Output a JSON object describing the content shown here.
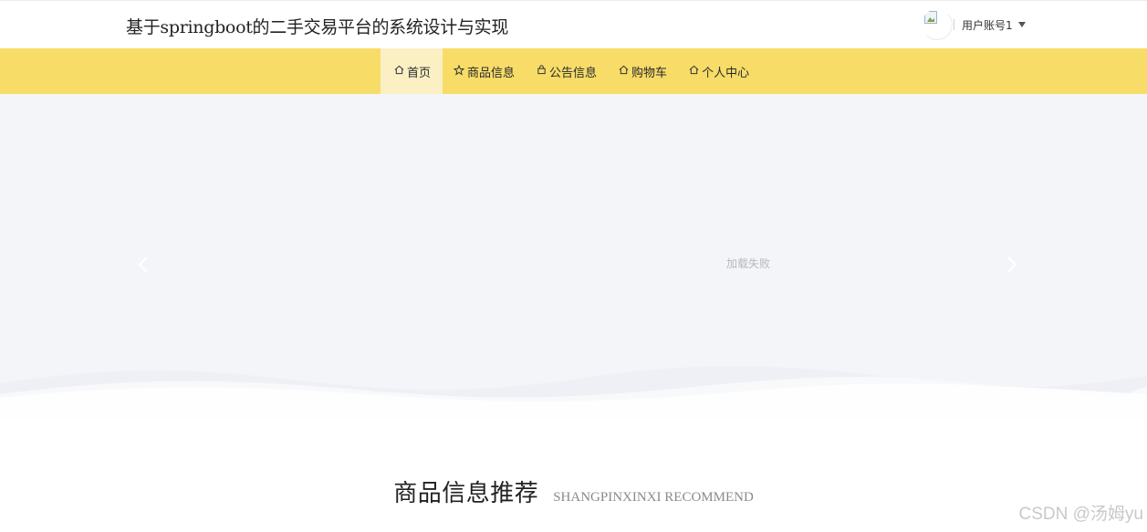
{
  "header": {
    "site_title": "基于springboot的二手交易平台的系统设计与实现",
    "user_name": "用户账号1"
  },
  "nav": {
    "items": [
      {
        "label": "首页",
        "icon": "home-icon",
        "active": true
      },
      {
        "label": "商品信息",
        "icon": "star-icon",
        "active": false
      },
      {
        "label": "公告信息",
        "icon": "bag-icon",
        "active": false
      },
      {
        "label": "购物车",
        "icon": "home-icon",
        "active": false
      },
      {
        "label": "个人中心",
        "icon": "home-icon",
        "active": false
      }
    ]
  },
  "banner": {
    "status_text": "加载失败",
    "prev_icon": "chevron-left-icon",
    "next_icon": "chevron-right-icon"
  },
  "section": {
    "title_cn": "商品信息推荐",
    "title_en": "SHANGPINXINXI RECOMMEND"
  },
  "watermark": "CSDN @汤姆yu",
  "colors": {
    "nav_background": "#f7dc68",
    "nav_active": "#fbf0c4",
    "banner_background": "#f4f5f8"
  }
}
